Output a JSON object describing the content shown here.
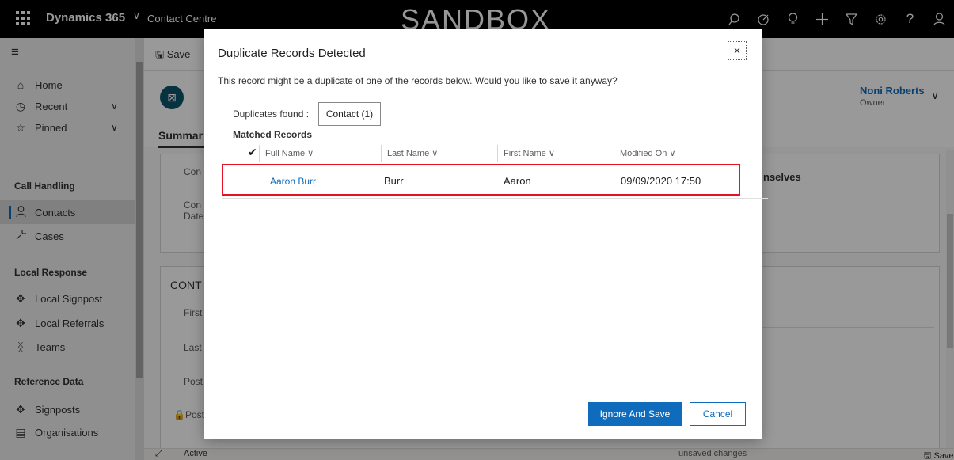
{
  "topbar": {
    "app_name": "Dynamics 365",
    "app_chevron": "∨",
    "area_name": "Contact Centre",
    "environment_banner": "SANDBOX",
    "icons": [
      "search-icon",
      "assistant-icon",
      "lightbulb-icon",
      "add-icon",
      "filter-icon",
      "settings-icon",
      "help-icon",
      "user-icon"
    ]
  },
  "sitemap": {
    "menu_icon": "≡",
    "items": [
      {
        "label": "Home",
        "icon": "home-icon"
      },
      {
        "label": "Recent",
        "icon": "clock-icon",
        "chevron": "∨"
      },
      {
        "label": "Pinned",
        "icon": "pin-icon",
        "chevron": "∨"
      }
    ],
    "groups": [
      {
        "title": "Call Handling",
        "items": [
          {
            "label": "Contacts",
            "icon": "person-icon",
            "active": true
          },
          {
            "label": "Cases",
            "icon": "wrench-icon"
          }
        ]
      },
      {
        "title": "Local Response",
        "items": [
          {
            "label": "Local Signpost",
            "icon": "puzzle-icon"
          },
          {
            "label": "Local Referrals",
            "icon": "puzzle-icon"
          },
          {
            "label": "Teams",
            "icon": "team-icon"
          }
        ]
      },
      {
        "title": "Reference Data",
        "items": [
          {
            "label": "Signposts",
            "icon": "puzzle-icon"
          },
          {
            "label": "Organisations",
            "icon": "building-icon"
          }
        ]
      }
    ]
  },
  "command_bar": {
    "save_label": "Save"
  },
  "form": {
    "owner_name": "Noni Roberts",
    "owner_label": "Owner",
    "tab_summary": "Summar",
    "section_text_1": "Con",
    "section_text_2": "Con",
    "section_text_3": "Date",
    "section_heading_contact": "CONT",
    "field_first": "First",
    "field_last": "Last",
    "field_post": "Post",
    "field_post2": "Post",
    "themselves_text": "nselves"
  },
  "status_bar": {
    "status": "Active",
    "unsaved": "unsaved changes",
    "save": "Save"
  },
  "dialog": {
    "title": "Duplicate Records Detected",
    "close": "×",
    "message": "This record might be a duplicate of one of the records below. Would you like to save it anyway?",
    "duplicates_label": "Duplicates found :",
    "duplicates_tab": "Contact (1)",
    "matched_heading": "Matched Records",
    "columns": [
      "Full Name ∨",
      "Last Name ∨",
      "First Name ∨",
      "Modified On ∨"
    ],
    "rows": [
      {
        "full_name": "Aaron Burr",
        "last_name": "Burr",
        "first_name": "Aaron",
        "modified_on": "09/09/2020 17:50"
      }
    ],
    "primary_button": "Ignore And Save",
    "secondary_button": "Cancel"
  }
}
